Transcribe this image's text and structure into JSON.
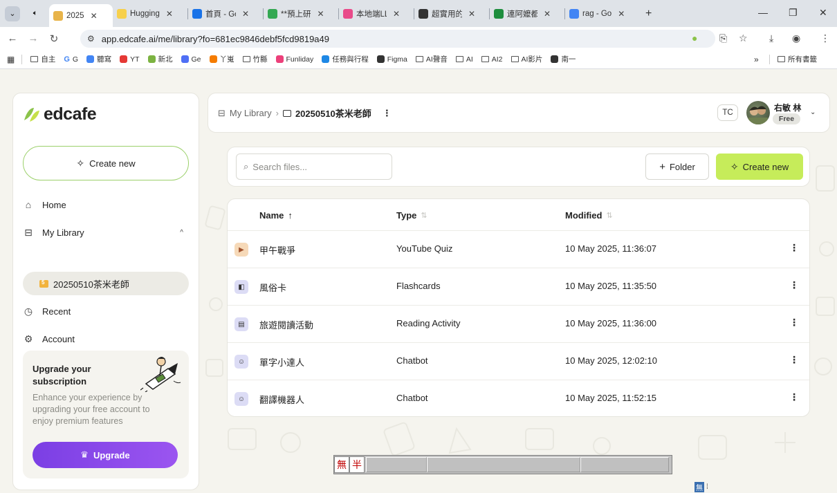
{
  "browser": {
    "tabs": [
      {
        "label": "2025",
        "fav": "#e8b44a",
        "active": true
      },
      {
        "label": "Hugging",
        "fav": "#f7d04c"
      },
      {
        "label": "首頁 - Go",
        "fav": "#1a73e8"
      },
      {
        "label": "**預上研",
        "fav": "#34a853"
      },
      {
        "label": "本地端LL",
        "fav": "#e94b8a"
      },
      {
        "label": "超實用的",
        "fav": "#333333"
      },
      {
        "label": "連阿嬤都",
        "fav": "#1e8e3e"
      },
      {
        "label": "rag - Go",
        "fav": "#4285f4"
      }
    ],
    "url": "app.edcafe.ai/me/library?fo=681ec9846debf5fcd9819a49",
    "bookmarks": [
      {
        "label": "自主",
        "type": "folder"
      },
      {
        "label": "G",
        "type": "g"
      },
      {
        "label": "聽寫",
        "type": "icon",
        "color": "#4285f4"
      },
      {
        "label": "YT",
        "type": "icon",
        "color": "#e53935"
      },
      {
        "label": "新北",
        "type": "icon",
        "color": "#7cb342"
      },
      {
        "label": "Ge",
        "type": "icon",
        "color": "#4f6ff5"
      },
      {
        "label": "丫嵬",
        "type": "icon",
        "color": "#f57c00"
      },
      {
        "label": "竹縣",
        "type": "folder"
      },
      {
        "label": "Funliday",
        "type": "icon",
        "color": "#ec407a"
      },
      {
        "label": "任務與行程",
        "type": "icon",
        "color": "#1e88e5"
      },
      {
        "label": "Figma",
        "type": "icon",
        "color": "#333333"
      },
      {
        "label": "AI聲音",
        "type": "folder"
      },
      {
        "label": "AI",
        "type": "folder"
      },
      {
        "label": "AI2",
        "type": "folder"
      },
      {
        "label": "AI影片",
        "type": "folder"
      },
      {
        "label": "南一",
        "type": "icon",
        "color": "#333333"
      }
    ],
    "bookmarks_more": "»",
    "all_bookmarks": "所有書籤"
  },
  "sidebar": {
    "logo": "edcafe",
    "create_new": "Create new",
    "nav": {
      "home": "Home",
      "my_library": "My Library",
      "library_child": "20250510茶米老師",
      "recent": "Recent",
      "account": "Account"
    },
    "upgrade": {
      "title": "Upgrade your subscription",
      "description": "Enhance your experience by upgrading your free account to enjoy premium features",
      "button": "Upgrade"
    }
  },
  "header": {
    "breadcrumb_root": "My Library",
    "breadcrumb_sep": "›",
    "breadcrumb_current": "20250510茶米老師",
    "initials": "TC",
    "user_name": "右敏 林",
    "plan": "Free"
  },
  "toolbar": {
    "search_placeholder": "Search files...",
    "folder_button": "Folder",
    "create_button": "Create new"
  },
  "table": {
    "columns": {
      "name": "Name",
      "type": "Type",
      "modified": "Modified"
    },
    "rows": [
      {
        "name": "甲午戰爭",
        "type": "YouTube Quiz",
        "modified": "10 May 2025, 11:36:07",
        "icon": "youtube-quiz-icon",
        "icon_color": "#f6d9b8"
      },
      {
        "name": "風俗卡",
        "type": "Flashcards",
        "modified": "10 May 2025, 11:35:50",
        "icon": "flashcards-icon",
        "icon_color": "#dcdcf5"
      },
      {
        "name": "旅遊閱讀活動",
        "type": "Reading Activity",
        "modified": "10 May 2025, 11:36:00",
        "icon": "reading-activity-icon",
        "icon_color": "#dcdcf5"
      },
      {
        "name": "單字小達人",
        "type": "Chatbot",
        "modified": "10 May 2025, 12:02:10",
        "icon": "chatbot-icon",
        "icon_color": "#dcdcf5"
      },
      {
        "name": "翻譯機器人",
        "type": "Chatbot",
        "modified": "10 May 2025, 11:52:15",
        "icon": "chatbot-icon",
        "icon_color": "#dcdcf5"
      }
    ]
  },
  "ime": {
    "mode_1": "無",
    "mode_2": "半",
    "mini": "無"
  },
  "colors": {
    "accent_green": "#c6ec5a",
    "upgrade_purple": "#7b3fe4",
    "app_bg": "#f5f4ee"
  }
}
